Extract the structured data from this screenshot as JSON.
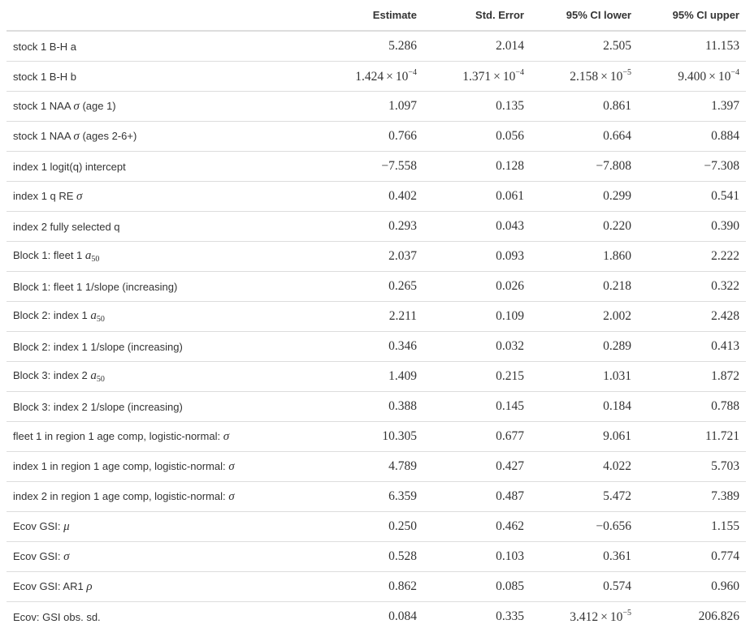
{
  "table": {
    "columns": [
      "",
      "Estimate",
      "Std. Error",
      "95% CI lower",
      "95% CI upper"
    ],
    "rows": [
      {
        "label": "stock 1 B-H a",
        "sym": "",
        "sub": "",
        "v": [
          "5.286",
          "2.014",
          "2.505",
          "11.153"
        ]
      },
      {
        "label": "stock 1 B-H b",
        "sym": "",
        "sub": "",
        "v": [
          {
            "m": "1.424",
            "e": "−4"
          },
          {
            "m": "1.371",
            "e": "−4"
          },
          {
            "m": "2.158",
            "e": "−5"
          },
          {
            "m": "9.400",
            "e": "−4"
          }
        ]
      },
      {
        "label": "stock 1 NAA ",
        "sym": "σ",
        "sub": "",
        "tail": " (age 1)",
        "v": [
          "1.097",
          "0.135",
          "0.861",
          "1.397"
        ]
      },
      {
        "label": "stock 1 NAA ",
        "sym": "σ",
        "sub": "",
        "tail": " (ages 2-6+)",
        "v": [
          "0.766",
          "0.056",
          "0.664",
          "0.884"
        ]
      },
      {
        "label": "index 1 logit(q) intercept",
        "sym": "",
        "sub": "",
        "v": [
          "−7.558",
          "0.128",
          "−7.808",
          "−7.308"
        ]
      },
      {
        "label": "index 1 q RE ",
        "sym": "σ",
        "sub": "",
        "v": [
          "0.402",
          "0.061",
          "0.299",
          "0.541"
        ]
      },
      {
        "label": "index 2 fully selected q",
        "sym": "",
        "sub": "",
        "v": [
          "0.293",
          "0.043",
          "0.220",
          "0.390"
        ]
      },
      {
        "label": "Block 1: fleet 1 ",
        "sym": "a",
        "sub": "50",
        "v": [
          "2.037",
          "0.093",
          "1.860",
          "2.222"
        ]
      },
      {
        "label": "Block 1: fleet 1 1/slope (increasing)",
        "sym": "",
        "sub": "",
        "v": [
          "0.265",
          "0.026",
          "0.218",
          "0.322"
        ]
      },
      {
        "label": "Block 2: index 1 ",
        "sym": "a",
        "sub": "50",
        "v": [
          "2.211",
          "0.109",
          "2.002",
          "2.428"
        ]
      },
      {
        "label": "Block 2: index 1 1/slope (increasing)",
        "sym": "",
        "sub": "",
        "v": [
          "0.346",
          "0.032",
          "0.289",
          "0.413"
        ]
      },
      {
        "label": "Block 3: index 2 ",
        "sym": "a",
        "sub": "50",
        "v": [
          "1.409",
          "0.215",
          "1.031",
          "1.872"
        ]
      },
      {
        "label": "Block 3: index 2 1/slope (increasing)",
        "sym": "",
        "sub": "",
        "v": [
          "0.388",
          "0.145",
          "0.184",
          "0.788"
        ]
      },
      {
        "label": "fleet 1 in region 1 age comp, logistic-normal: ",
        "sym": "σ",
        "sub": "",
        "v": [
          "10.305",
          "0.677",
          "9.061",
          "11.721"
        ]
      },
      {
        "label": "index 1 in region 1 age comp, logistic-normal: ",
        "sym": "σ",
        "sub": "",
        "v": [
          "4.789",
          "0.427",
          "4.022",
          "5.703"
        ]
      },
      {
        "label": "index 2 in region 1 age comp, logistic-normal: ",
        "sym": "σ",
        "sub": "",
        "v": [
          "6.359",
          "0.487",
          "5.472",
          "7.389"
        ]
      },
      {
        "label": "Ecov GSI: ",
        "sym": "μ",
        "sub": "",
        "v": [
          "0.250",
          "0.462",
          "−0.656",
          "1.155"
        ]
      },
      {
        "label": "Ecov GSI: ",
        "sym": "σ",
        "sub": "",
        "v": [
          "0.528",
          "0.103",
          "0.361",
          "0.774"
        ]
      },
      {
        "label": "Ecov GSI: AR1 ",
        "sym": "ρ",
        "sub": "",
        "v": [
          "0.862",
          "0.085",
          "0.574",
          "0.960"
        ]
      },
      {
        "label": "Ecov: GSI obs. sd.",
        "sym": "",
        "sub": "",
        "v": [
          "0.084",
          "0.335",
          {
            "m": "3.412",
            "e": "−5"
          },
          "206.826"
        ]
      }
    ]
  }
}
